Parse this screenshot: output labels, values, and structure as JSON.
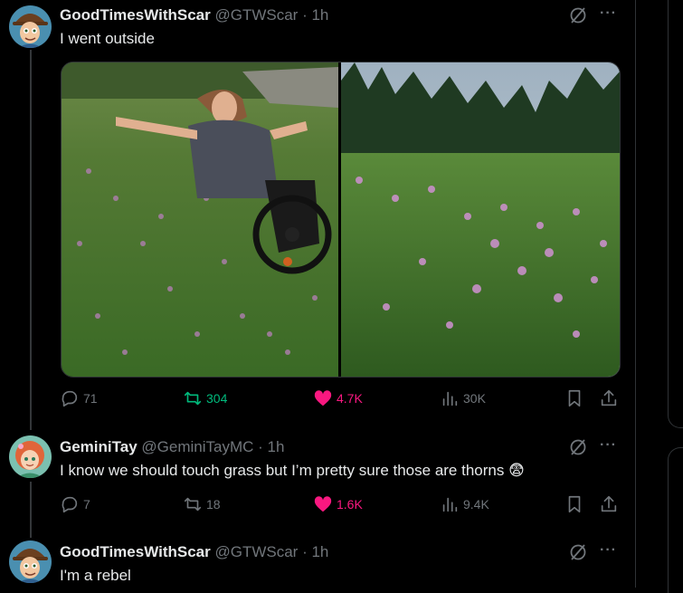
{
  "tweets": [
    {
      "name": "GoodTimesWithScar",
      "handle": "@GTWScar",
      "time": "· 1h",
      "text": "I went outside",
      "replies": "71",
      "retweets": "304",
      "likes": "4.7K",
      "views": "30K",
      "liked": true,
      "retweeted": true,
      "images": [
        "photo-man-in-wheelchair-in-thistle-field",
        "photo-thistle-field-with-forest"
      ]
    },
    {
      "name": "GeminiTay",
      "handle": "@GeminiTayMC",
      "time": "· 1h",
      "text": "I know we should touch grass but I’m pretty sure those are thorns 😨",
      "replies": "7",
      "retweets": "18",
      "likes": "1.6K",
      "views": "9.4K",
      "liked": true,
      "retweeted": false
    },
    {
      "name": "GoodTimesWithScar",
      "handle": "@GTWScar",
      "time": "· 1h",
      "text": "I'm a rebel"
    }
  ],
  "icons": {
    "reply": "reply-icon",
    "retweet": "retweet-icon",
    "like": "heart-icon",
    "views": "views-icon",
    "bookmark": "bookmark-icon",
    "share": "share-icon",
    "grok": "grok-icon",
    "more": "more-icon"
  },
  "colors": {
    "background": "#000000",
    "text": "#e7e9ea",
    "muted": "#71767b",
    "retweet": "#00ba7c",
    "like": "#f91880"
  }
}
